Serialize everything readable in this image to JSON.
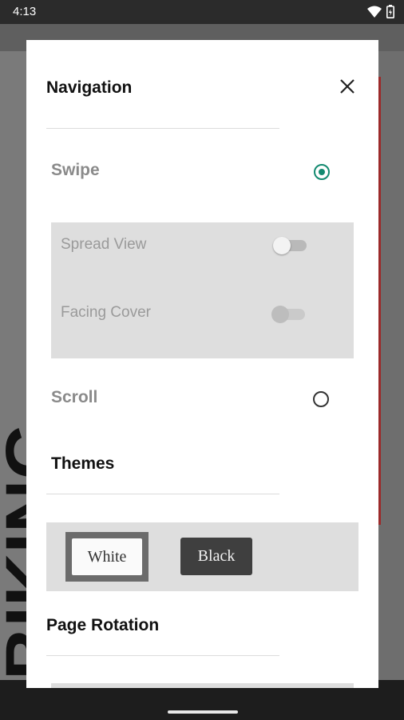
{
  "status_bar": {
    "time": "4:13"
  },
  "background": {
    "vertical_text": "BIKING"
  },
  "dialog": {
    "title": "Navigation",
    "navigation_options": [
      {
        "label": "Swipe",
        "selected": true
      },
      {
        "label": "Scroll",
        "selected": false
      }
    ],
    "swipe_settings": [
      {
        "label": "Spread View",
        "on": false
      },
      {
        "label": "Facing Cover",
        "on": false
      }
    ],
    "themes": {
      "heading": "Themes",
      "options": [
        {
          "label": "White",
          "selected": true
        },
        {
          "label": "Black",
          "selected": false
        }
      ]
    },
    "page_rotation": {
      "heading": "Page Rotation"
    }
  },
  "colors": {
    "accent": "#138a70"
  }
}
